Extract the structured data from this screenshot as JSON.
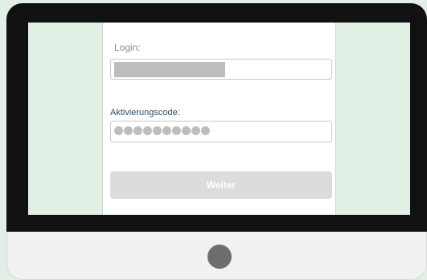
{
  "form": {
    "login_label": "Login:",
    "login_value": "",
    "code_label": "Aktivierungscode:",
    "code_value": "●●●●●●●●●●",
    "submit_label": "Weiter"
  },
  "colors": {
    "background": "#e3efe6",
    "bezel": "#111111",
    "panel": "#ffffff",
    "mask": "#bdbdbd",
    "button": "#dcdcdc",
    "code_label": "#2e4a66"
  },
  "icons": {
    "home_button": "home-button-circle"
  }
}
